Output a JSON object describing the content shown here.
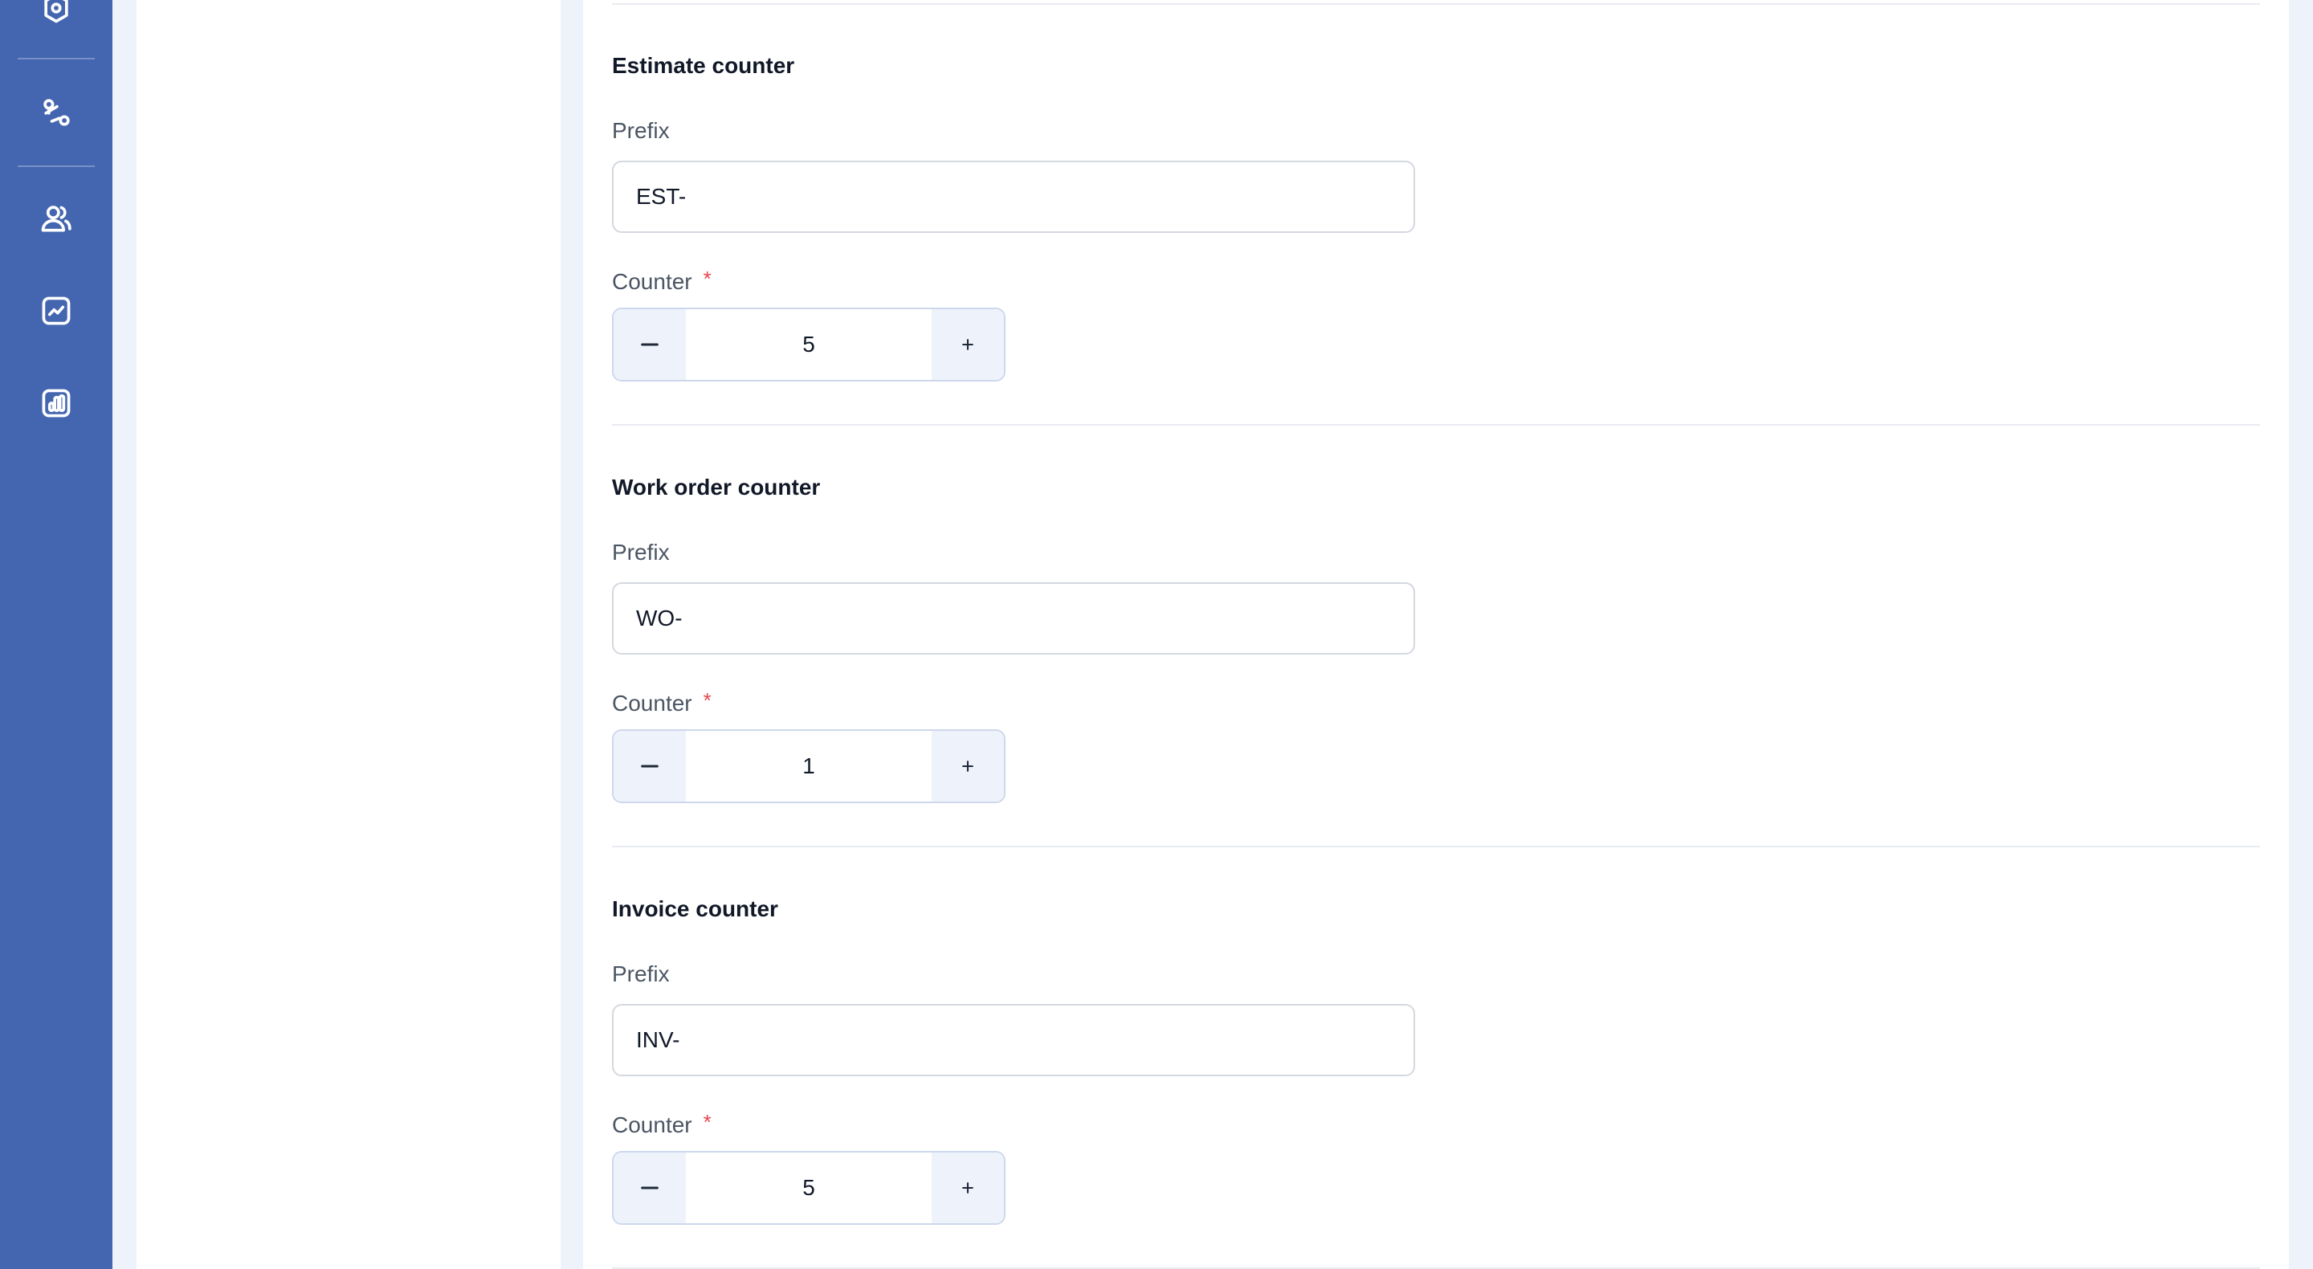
{
  "sidebar": {
    "icons": [
      "settings-shield-icon",
      "route-icon",
      "users-icon",
      "activity-chart-icon",
      "bar-chart-icon"
    ]
  },
  "sections": [
    {
      "title": "Estimate counter",
      "prefix_label": "Prefix",
      "prefix_value": "EST-",
      "counter_label": "Counter",
      "required_mark": "*",
      "counter_value": "5"
    },
    {
      "title": "Work order counter",
      "prefix_label": "Prefix",
      "prefix_value": "WO-",
      "counter_label": "Counter",
      "required_mark": "*",
      "counter_value": "1"
    },
    {
      "title": "Invoice counter",
      "prefix_label": "Prefix",
      "prefix_value": "INV-",
      "counter_label": "Counter",
      "required_mark": "*",
      "counter_value": "5"
    }
  ],
  "colors": {
    "sidebar": "#4466b0",
    "page_background": "#eef3fb",
    "required": "#e5484d"
  }
}
